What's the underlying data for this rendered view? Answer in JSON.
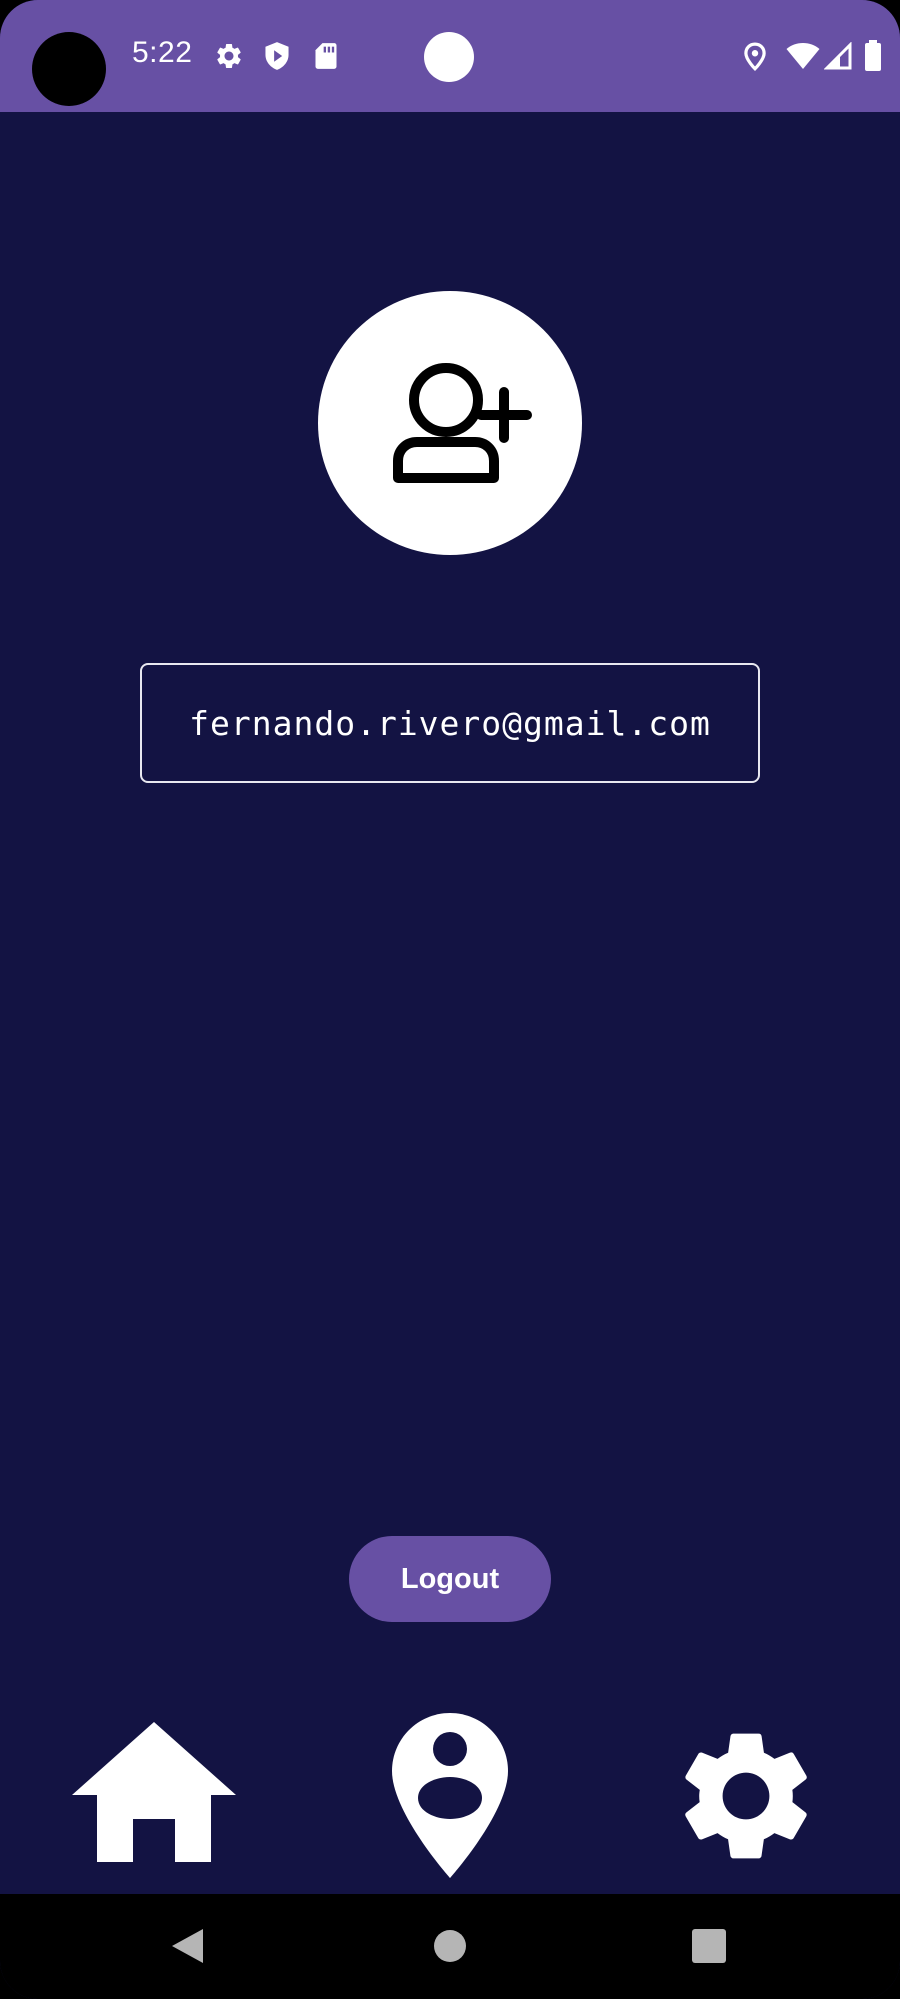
{
  "status_bar": {
    "time": "5:22",
    "background_color": "#6750a4",
    "left_icons": [
      "gear-icon",
      "shield-play-icon",
      "sd-card-icon"
    ],
    "right_icons": [
      "location-icon",
      "wifi-icon",
      "cellular-signal-icon",
      "battery-icon"
    ]
  },
  "profile": {
    "avatar_icon": "add-user-icon",
    "email": "fernando.rivero@gmail.com"
  },
  "actions": {
    "logout_label": "Logout",
    "logout_color": "#6750a4"
  },
  "bottom_nav": {
    "items": [
      {
        "icon": "home-icon"
      },
      {
        "icon": "user-location-pin-icon"
      },
      {
        "icon": "settings-gear-icon"
      }
    ]
  },
  "system_nav": {
    "buttons": [
      "back-icon",
      "home-circle-icon",
      "recents-icon"
    ]
  },
  "theme": {
    "background": "#131343",
    "accent": "#6750a4"
  }
}
